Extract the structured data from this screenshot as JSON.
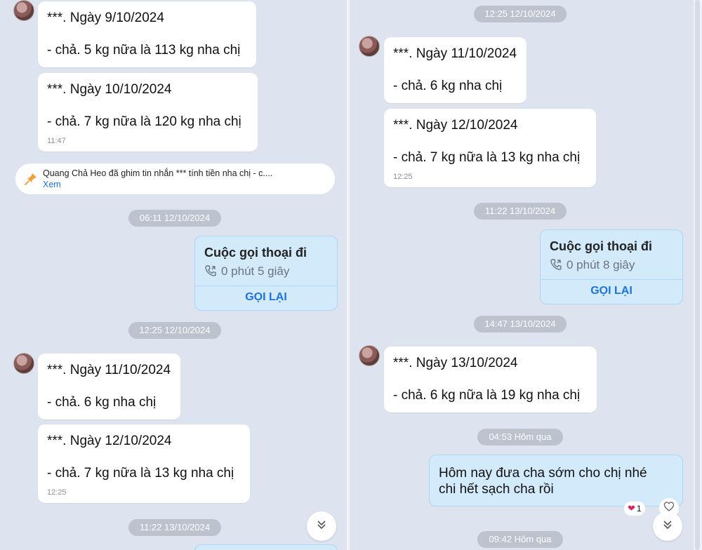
{
  "left": {
    "messages_top": [
      {
        "line1": "***. Ngày 9/10/2024",
        "line2": "- chả.   5 kg nữa là 113 kg nha chị"
      },
      {
        "line1": "***. Ngày 10/10/2024",
        "line2": "- chả.   7 kg nữa là 120 kg nha chị",
        "time": "11:47"
      }
    ],
    "pin": {
      "text": "Quang Chả Heo đã ghim tin nhắn *** tính tiền nha chị   - c....",
      "link": "Xem"
    },
    "date_1": "06:11 12/10/2024",
    "call": {
      "title": "Cuộc gọi thoại đi",
      "duration": "0 phút 5 giây",
      "action": "GỌI LẠI"
    },
    "date_2": "12:25 12/10/2024",
    "messages_bottom": [
      {
        "line1": "***. Ngày 11/10/2024",
        "line2": "- chả.   6  kg nha chị"
      },
      {
        "line1": "***. Ngày 12/10/2024",
        "line2": "- chả.   7 kg nữa là 13 kg nha chị",
        "time": "12:25"
      }
    ],
    "date_3": "11:22 13/10/2024"
  },
  "right": {
    "date_0": "12:25 12/10/2024",
    "messages_top": [
      {
        "line1": "***. Ngày 11/10/2024",
        "line2": "- chả.   6  kg nha chị"
      },
      {
        "line1": "***. Ngày 12/10/2024",
        "line2": "- chả.   7 kg nữa là 13 kg nha chị",
        "time": "12:25"
      }
    ],
    "date_1": "11:22 13/10/2024",
    "call": {
      "title": "Cuộc gọi thoại đi",
      "duration": "0 phút 8 giây",
      "action": "GỌI LẠI"
    },
    "date_2": "14:47 13/10/2024",
    "message_3": {
      "line1": "***. Ngày 13/10/2024",
      "line2": "- chả.   6 kg nữa là 19 kg nha chị"
    },
    "date_3": "04:53 Hôm qua",
    "sent": {
      "text": "Hôm nay đưa cha sớm cho chị nhé chi hết sạch cha rồi"
    },
    "reaction": {
      "emoji": "❤",
      "count": "1"
    },
    "date_4": "09:42 Hôm qua"
  },
  "colors": {
    "accent": "#1b74e4",
    "sent_bg": "#d3eafb",
    "chat_bg": "#dde4ef",
    "pill": "#bcc3ce"
  },
  "icons": {
    "pin": "pin-icon",
    "phone": "phone-icon",
    "scroll_down": "chevron-double-down-icon",
    "heart": "heart-icon"
  }
}
